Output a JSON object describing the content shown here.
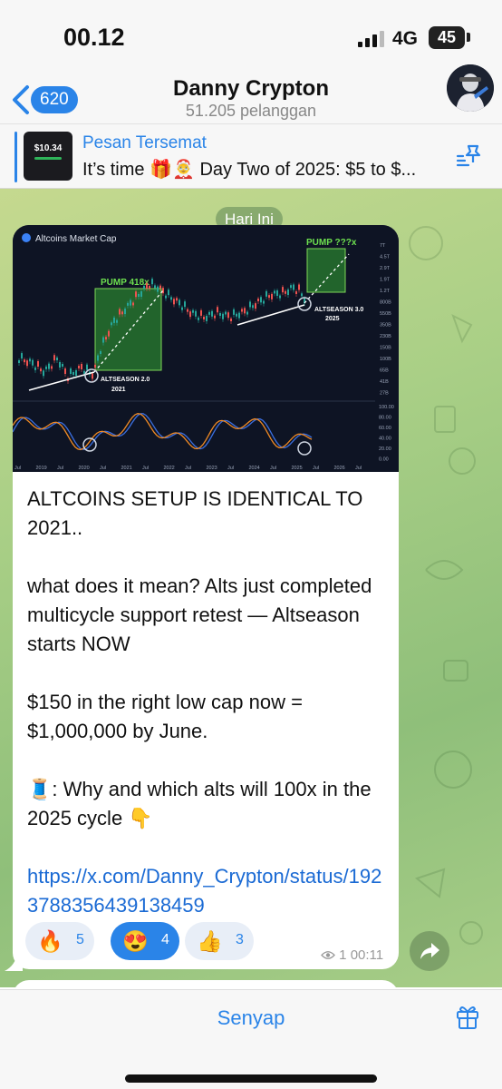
{
  "status_bar": {
    "time": "00.12",
    "network": "4G",
    "battery": "45"
  },
  "header": {
    "back_count": "620",
    "title": "Danny Crypton",
    "subtitle": "51.205 pelanggan"
  },
  "pinned": {
    "title": "Pesan Tersemat",
    "text": "It’s time 🎁🤶 Day Two of 2025: $5 to $...",
    "thumb_value": "$10.34"
  },
  "date_label": "Hari Ini",
  "chart": {
    "title": "Altcoins Market Cap",
    "pump_label_1": "PUMP 418x",
    "pump_label_2": "PUMP ???x",
    "altseason_2_line1": "ALTSEASON 2.0",
    "altseason_2_line2": "2021",
    "altseason_3_line1": "ALTSEASON 3.0",
    "altseason_3_line2": "2025",
    "price_ticks": [
      "7T",
      "4.5T",
      "2.9T",
      "1.9T",
      "1.2T",
      "800B",
      "550B",
      "350B",
      "230B",
      "150B",
      "100B",
      "65B",
      "41B",
      "27B"
    ],
    "osc_ticks": [
      "100.00",
      "80.00",
      "60.00",
      "40.00",
      "20.00",
      "0.00"
    ],
    "x_ticks": [
      "Jul",
      "2019",
      "Jul",
      "2020",
      "Jul",
      "2021",
      "Jul",
      "2022",
      "Jul",
      "2023",
      "Jul",
      "2024",
      "Jul",
      "2025",
      "Jul",
      "2026",
      "Jul"
    ]
  },
  "message": {
    "paragraphs": [
      "ALTCOINS SETUP IS IDENTICAL TO 2021..",
      "",
      "what does it mean? Alts just completed multicycle support retest — Altseason starts NOW",
      "",
      "$150 in the right low cap now = $1,000,000 by June.",
      "",
      "🧵: Why and which alts will 100x in the 2025 cycle 👇",
      ""
    ],
    "link": "https://x.com/Danny_Crypton/status/1923788356439138459"
  },
  "reactions": [
    {
      "emoji": "🔥",
      "count": "5",
      "active": false
    },
    {
      "emoji": "😍",
      "count": "4",
      "active": true
    },
    {
      "emoji": "👍",
      "count": "3",
      "active": false
    }
  ],
  "meta": {
    "views": "1",
    "time": "00:11"
  },
  "bottom": {
    "mute_label": "Senyap"
  },
  "colors": {
    "accent": "#2a84e8",
    "chart_bg": "#0e1424",
    "pump_green": "#2f9a36",
    "link": "#1a6ad4"
  }
}
